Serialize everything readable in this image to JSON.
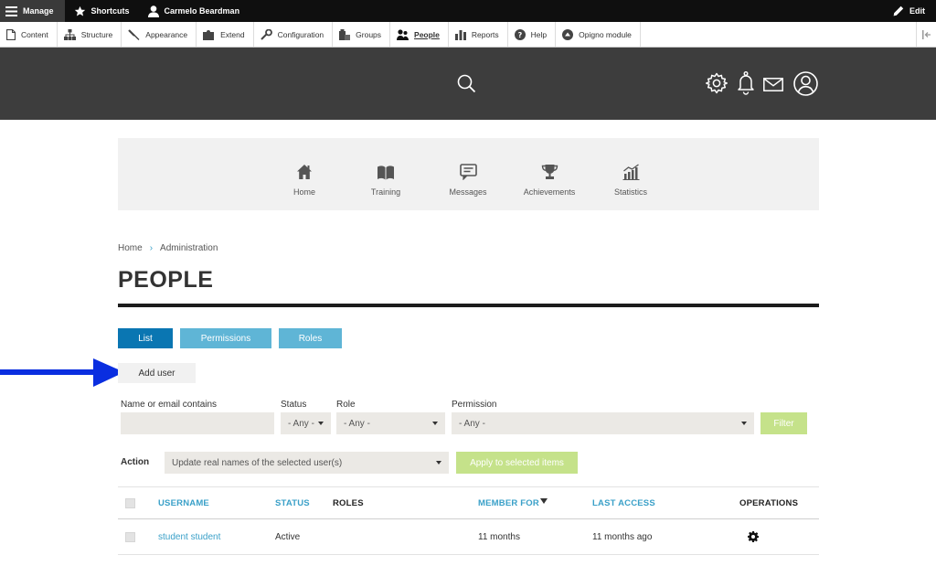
{
  "toolbar": {
    "manage_label": "Manage",
    "shortcuts_label": "Shortcuts",
    "user_name": "Carmelo Beardman",
    "edit_label": "Edit"
  },
  "tray": {
    "items": [
      {
        "label": "Content",
        "icon": "page-icon"
      },
      {
        "label": "Structure",
        "icon": "sitemap-icon"
      },
      {
        "label": "Appearance",
        "icon": "paintbrush-icon"
      },
      {
        "label": "Extend",
        "icon": "puzzle-icon"
      },
      {
        "label": "Configuration",
        "icon": "wrench-icon"
      },
      {
        "label": "Groups",
        "icon": "groups-icon"
      },
      {
        "label": "People",
        "icon": "people-icon",
        "active": true
      },
      {
        "label": "Reports",
        "icon": "bar-chart-icon"
      },
      {
        "label": "Help",
        "icon": "help-icon"
      },
      {
        "label": "Opigno module",
        "icon": "opigno-icon"
      }
    ]
  },
  "main_nav": {
    "items": [
      {
        "label": "Home",
        "icon": "home-icon"
      },
      {
        "label": "Training",
        "icon": "book-icon"
      },
      {
        "label": "Messages",
        "icon": "message-icon"
      },
      {
        "label": "Achievements",
        "icon": "trophy-icon"
      },
      {
        "label": "Statistics",
        "icon": "statistics-icon"
      }
    ]
  },
  "breadcrumb": {
    "items": [
      "Home",
      "Administration"
    ],
    "separator": "›"
  },
  "page_title": "PEOPLE",
  "tabs": {
    "list": "List",
    "permissions": "Permissions",
    "roles": "Roles"
  },
  "add_user_label": "Add user",
  "filters": {
    "name_label": "Name or email contains",
    "name_value": "",
    "status_label": "Status",
    "status_value": "- Any -",
    "role_label": "Role",
    "role_value": "- Any -",
    "permission_label": "Permission",
    "permission_value": "- Any -",
    "filter_button": "Filter"
  },
  "bulk": {
    "action_label": "Action",
    "action_value": "Update real names of the selected user(s)",
    "apply_button": "Apply to selected items"
  },
  "table": {
    "headers": {
      "username": "USERNAME",
      "status": "STATUS",
      "roles": "ROLES",
      "member_for": "MEMBER FOR",
      "last_access": "LAST ACCESS",
      "operations": "OPERATIONS"
    },
    "rows": [
      {
        "username": "student student",
        "status": "Active",
        "roles": "",
        "member_for": "11 months",
        "last_access": "11 months ago"
      }
    ]
  },
  "colors": {
    "toolbar_bg": "#0f0f0f",
    "header_bg": "#3d3d3d",
    "tab_active": "#0a76b2",
    "tab_inactive": "#5fb5d6",
    "link": "#3aa0c8",
    "filter_button": "#c5e28a",
    "annotation_arrow": "#0a2ee0"
  }
}
